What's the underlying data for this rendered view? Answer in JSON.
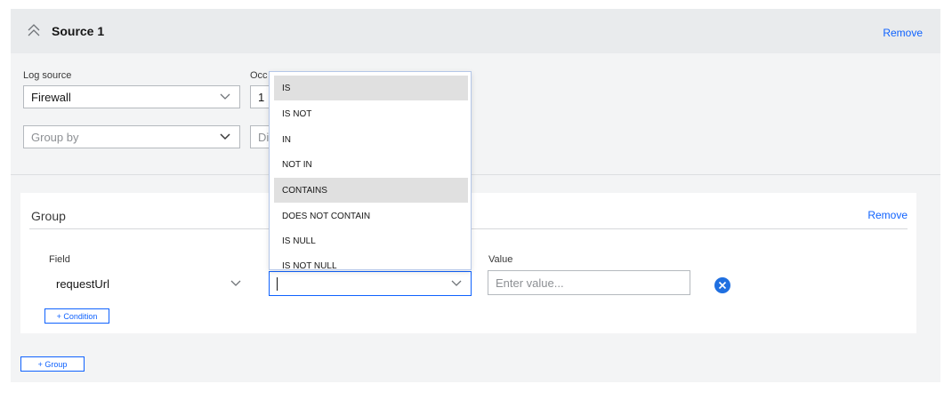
{
  "source": {
    "title": "Source 1",
    "remove_label": "Remove",
    "log_source_label": "Log source",
    "log_source_value": "Firewall",
    "occurrences_label": "Occ",
    "occurrences_value": "1",
    "group_by_placeholder": "Group by",
    "second_placeholder": "Di"
  },
  "group": {
    "title": "Group",
    "remove_label": "Remove",
    "field_label": "Field",
    "field_value": "requestUrl",
    "operator_value": "",
    "value_label": "Value",
    "value_placeholder": "Enter value...",
    "add_condition_label": "+ Condition"
  },
  "add_group_label": "+ Group",
  "operator_dropdown": {
    "options": [
      "IS",
      "IS NOT",
      "IN",
      "NOT IN",
      "CONTAINS",
      "DOES NOT CONTAIN",
      "IS NULL",
      "IS NOT NULL"
    ],
    "highlighted": [
      "IS",
      "CONTAINS"
    ]
  },
  "colors": {
    "accent": "#0f62fe",
    "card_bg": "#f3f4f5",
    "header_bg": "#e9ebed",
    "clear_button": "#1f6fe0"
  },
  "icons": {
    "collapse": "chevron-double-up-icon",
    "dropdown": "chevron-down-icon",
    "clear": "close-circle-icon"
  }
}
